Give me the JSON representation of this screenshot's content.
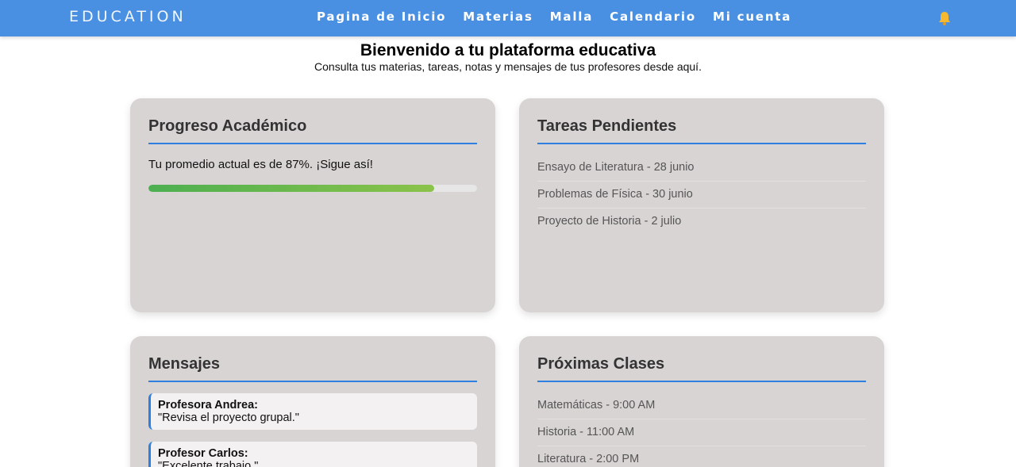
{
  "nav": {
    "brand": "EDUCATION",
    "links": [
      "Pagina de Inicio",
      "Materias",
      "Malla",
      "Calendario",
      "Mi cuenta"
    ],
    "bell_icon": "bell-icon",
    "bell_color": "#f5b82e",
    "bar_color": "#4a90e2"
  },
  "hero": {
    "title": "Bienvenido a tu plataforma educativa",
    "subtitle": "Consulta tus materias, tareas, notas y mensajes de tus profesores desde aquí."
  },
  "progress": {
    "title": "Progreso Académico",
    "text": "Tu promedio actual es de 87%. ¡Sigue así!",
    "value_percent": 87
  },
  "tasks": {
    "title": "Tareas Pendientes",
    "items": [
      "Ensayo de Literatura - 28 junio",
      "Problemas de Física - 30 junio",
      "Proyecto de Historia - 2 julio"
    ]
  },
  "messages": {
    "title": "Mensajes",
    "items": [
      {
        "sender": "Profesora Andrea:",
        "text": "\"Revisa el proyecto grupal.\""
      },
      {
        "sender": "Profesor Carlos:",
        "text": "\"Excelente trabajo.\""
      }
    ]
  },
  "classes": {
    "title": "Próximas Clases",
    "items": [
      "Matemáticas - 9:00 AM",
      "Historia - 11:00 AM",
      "Literatura - 2:00 PM"
    ]
  }
}
